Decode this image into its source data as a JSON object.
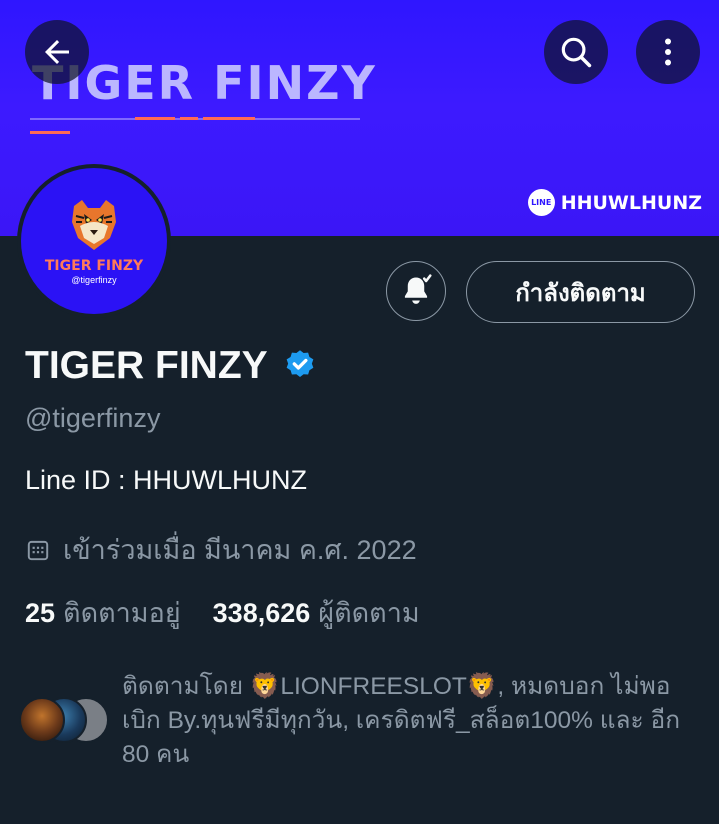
{
  "banner": {
    "title": "TIGER  FINZY",
    "line_badge": "HHUWLHUNZ",
    "line_logo": "LINE",
    "color": "#2f16ff",
    "accent": "#ff6a55"
  },
  "header": {
    "back_icon": "arrow-left-icon",
    "search_icon": "search-icon",
    "more_icon": "more-vertical-icon"
  },
  "avatar": {
    "name": "TIGER FINZY",
    "handle": "@tigerfinzy"
  },
  "actions": {
    "notify_icon": "bell-check-icon",
    "following_label": "กำลังติดตาม"
  },
  "profile": {
    "display_name": "TIGER FINZY",
    "verified_color": "#1d9bf0",
    "handle": "@tigerfinzy",
    "bio": "Line ID : HHUWLHUNZ",
    "joined": "เข้าร่วมเมื่อ มีนาคม ค.ศ. 2022"
  },
  "stats": {
    "following_count": "25",
    "following_label": "ติดตามอยู่",
    "followers_count": "338,626",
    "followers_label": "ผู้ติดตาม"
  },
  "followed_by": {
    "text": "ติดตามโดย 🦁LIONFREESLOT🦁, หมดบอก ไม่พอเบิก By.ทุนฟรีมีทุกวัน, เครดิตฟรี_สล็อต100% และ อีก 80 คน"
  }
}
